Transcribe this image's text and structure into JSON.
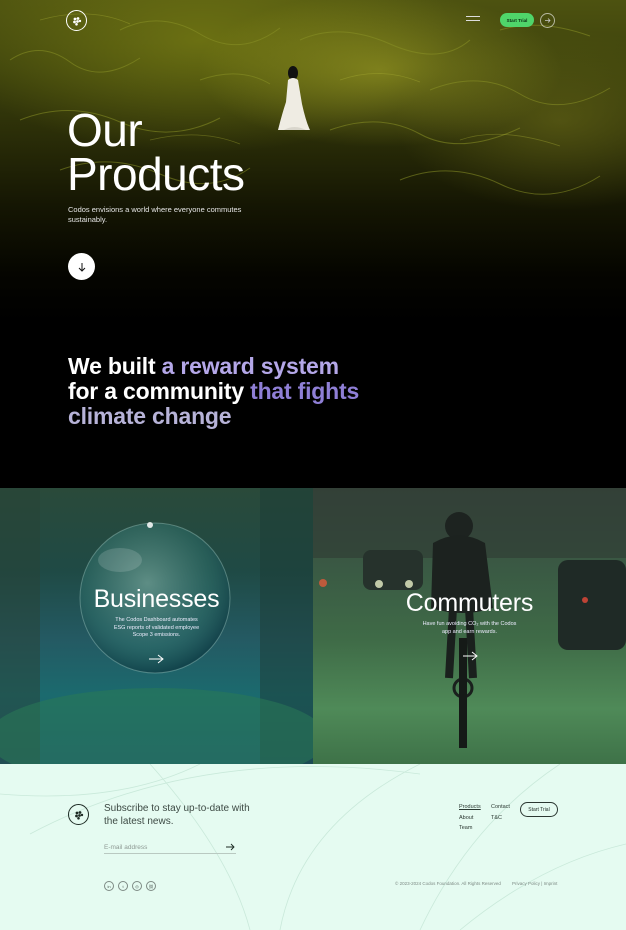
{
  "header": {
    "start_trial_label": "Start Trial"
  },
  "hero": {
    "title_line1": "Our",
    "title_line2": "Products",
    "subtitle": "Codos envisions a world where everyone commutes sustainably."
  },
  "mission": {
    "part1": "We built ",
    "part2": "a reward system",
    "part3": "for a community ",
    "part4": "that fights",
    "part5": "climate change"
  },
  "products": [
    {
      "title": "Businesses",
      "description_line1": "The Codos Dashboard automates",
      "description_line2": "ESG reports of validated employee",
      "description_line3": "Scope 3 emissions."
    },
    {
      "title": "Commuters",
      "description_line1": "Have fun avoiding CO₂ with the Codos",
      "description_line2": "app and earn rewards."
    }
  ],
  "footer": {
    "subscribe_text": "Subscribe to stay up-to-date with the latest news.",
    "email_placeholder": "E-mail address",
    "links_col1": [
      "Products",
      "About",
      "Team"
    ],
    "links_col2": [
      "Contact",
      "T&C"
    ],
    "start_trial_label": "Start Trial",
    "social_icons": [
      "linkedin-icon",
      "twitter-icon",
      "instagram-icon",
      "link-icon"
    ],
    "social_glyphs": [
      "in",
      "t",
      "◎",
      "⛓"
    ],
    "copyright": "© 2023-2024 Codos Foundation. All Rights Reserved",
    "privacy": "Privacy Policy | Imprint"
  },
  "colors": {
    "accent_green": "#4fd56a",
    "mission_purple": "#8f7fd6",
    "footer_bg": "#e5fbf1"
  }
}
